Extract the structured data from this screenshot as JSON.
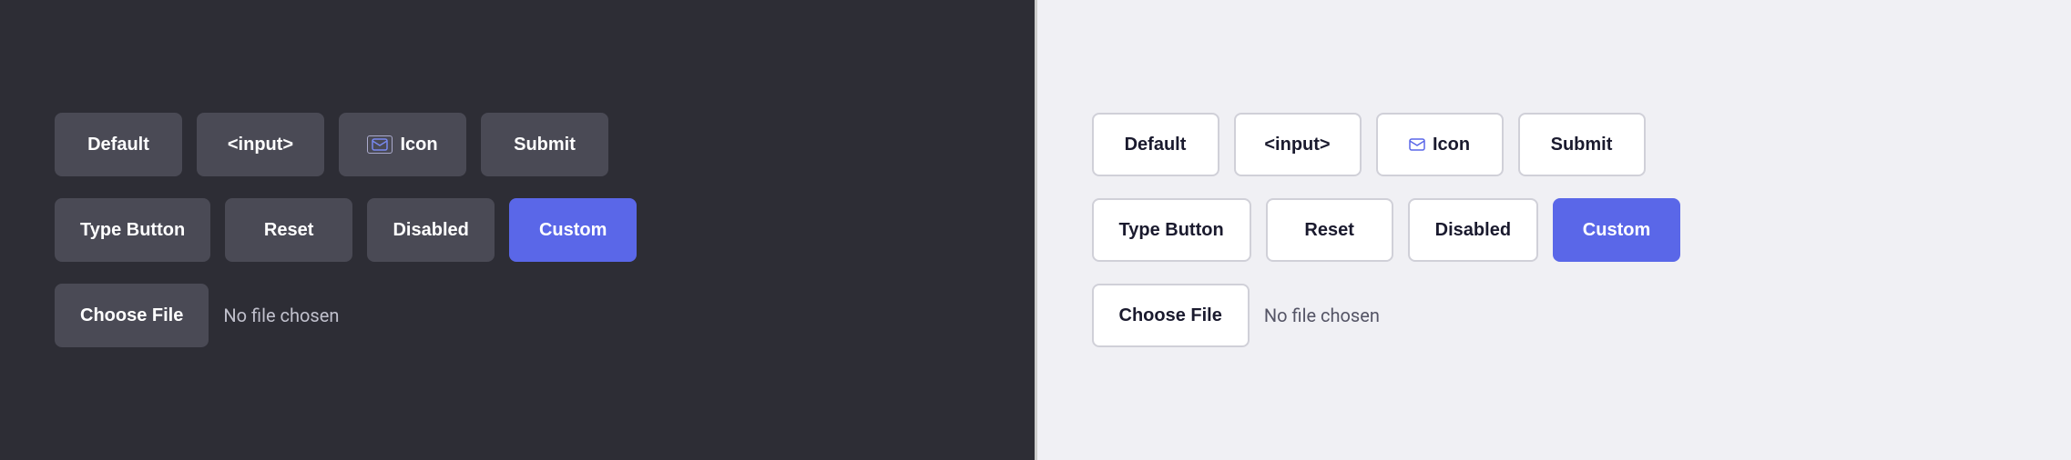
{
  "dark_panel": {
    "background": "#2d2d35",
    "rows": {
      "row1": [
        {
          "id": "default",
          "label": "Default",
          "icon": null
        },
        {
          "id": "input",
          "label": "<input>",
          "icon": null
        },
        {
          "id": "icon",
          "label": "Icon",
          "icon": "envelope"
        },
        {
          "id": "submit",
          "label": "Submit",
          "icon": null
        }
      ],
      "row2": [
        {
          "id": "type-button",
          "label": "Type Button",
          "icon": null
        },
        {
          "id": "reset",
          "label": "Reset",
          "icon": null
        },
        {
          "id": "disabled",
          "label": "Disabled",
          "icon": null
        },
        {
          "id": "custom",
          "label": "Custom",
          "icon": null
        }
      ]
    },
    "file_input": {
      "button_label": "Choose File",
      "status": "No file chosen"
    }
  },
  "light_panel": {
    "background": "#f0f0f4",
    "rows": {
      "row1": [
        {
          "id": "default",
          "label": "Default",
          "icon": null
        },
        {
          "id": "input",
          "label": "<input>",
          "icon": null
        },
        {
          "id": "icon",
          "label": "Icon",
          "icon": "envelope"
        },
        {
          "id": "submit",
          "label": "Submit",
          "icon": null
        }
      ],
      "row2": [
        {
          "id": "type-button",
          "label": "Type Button",
          "icon": null
        },
        {
          "id": "reset",
          "label": "Reset",
          "icon": null
        },
        {
          "id": "disabled",
          "label": "Disabled",
          "icon": null
        },
        {
          "id": "custom",
          "label": "Custom",
          "icon": null
        }
      ]
    },
    "file_input": {
      "button_label": "Choose File",
      "status": "No file chosen"
    }
  },
  "envelope_icon": "✉",
  "colors": {
    "custom_accent": "#5a67e8",
    "dark_btn": "#4a4a55",
    "light_btn_border": "#d0d0d8"
  }
}
